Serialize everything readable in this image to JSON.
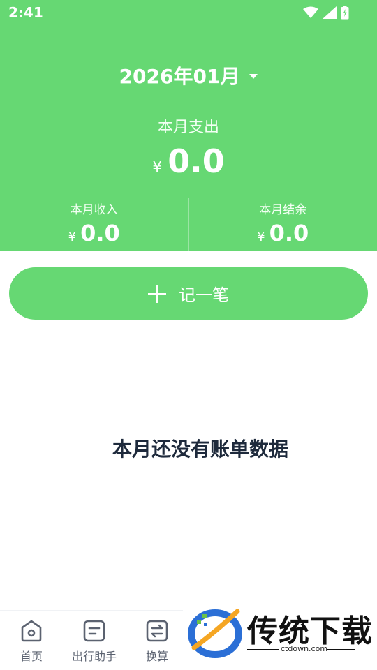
{
  "status_bar": {
    "time": "2:41",
    "icons": [
      "wifi-icon",
      "signal-icon",
      "battery-charging-icon"
    ]
  },
  "header": {
    "month": "2026年01月",
    "expense": {
      "label": "本月支出",
      "currency": "¥",
      "value": "0.0"
    },
    "income": {
      "label": "本月收入",
      "currency": "¥",
      "value": "0.0"
    },
    "balance": {
      "label": "本月结余",
      "currency": "¥",
      "value": "0.0"
    }
  },
  "record_button": {
    "label": "记一笔",
    "icon": "plus-icon"
  },
  "empty_state": {
    "text": "本月还没有账单数据"
  },
  "bottom_nav": [
    {
      "label": "首页",
      "icon": "home-icon"
    },
    {
      "label": "出行助手",
      "icon": "document-icon"
    },
    {
      "label": "换算",
      "icon": "exchange-icon"
    }
  ],
  "watermark": {
    "title": "传统下载",
    "url": "ctdown.com"
  },
  "colors": {
    "accent": "#66d873",
    "text_dark": "#1e2a3c",
    "nav_text": "#5b6270",
    "white": "#ffffff"
  }
}
